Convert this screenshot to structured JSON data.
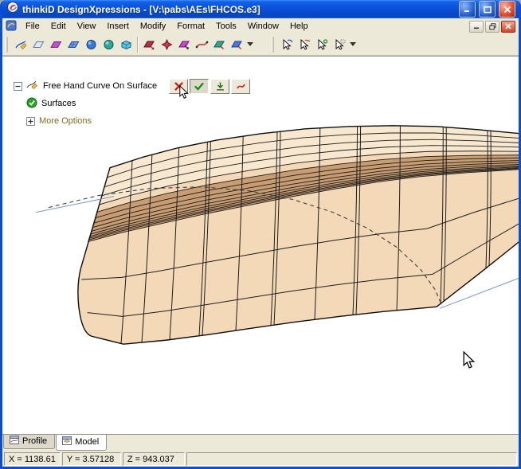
{
  "window": {
    "title": "thinkiD DesignXpressions - [V:\\pabs\\AEs\\FHCOS.e3]"
  },
  "menubar": {
    "items": [
      "File",
      "Edit",
      "View",
      "Insert",
      "Modify",
      "Format",
      "Tools",
      "Window",
      "Help"
    ]
  },
  "toolbar": {
    "icons": [
      "sketch-curve",
      "plane-surface",
      "patch-magenta",
      "mesh-surface",
      "sphere-blue",
      "sphere-teal",
      "box-solid",
      "modify-surface-red",
      "modify-star",
      "modify-magenta",
      "modify-curve",
      "modify-teal",
      "modify-blue",
      "group-dropdown",
      "select-curve-tool",
      "select-mesh-tool",
      "select-point-tool",
      "sketch-on-surface-tool",
      "select-dropdown"
    ]
  },
  "panel": {
    "header": "Free Hand Curve On Surface",
    "actions": [
      "cancel",
      "accept",
      "apply",
      "edit-curve"
    ],
    "surfaces_label": "Surfaces",
    "more_options_label": "More Options"
  },
  "tabs": [
    {
      "label": "Profile"
    },
    {
      "label": "Model"
    }
  ],
  "statusbar": {
    "x": "X = 1138.61",
    "y": "Y = 3.57128",
    "z": "Z = 943.037"
  },
  "colors": {
    "titlebar": "#0a50d8",
    "surface": "#f4d9b8",
    "surface_light": "#f8e8d0",
    "surface_dark": "#c99d72",
    "mesh_line": "#1d1d1d",
    "construction": "#7b97c6",
    "more_options": "#7f6f1f"
  }
}
